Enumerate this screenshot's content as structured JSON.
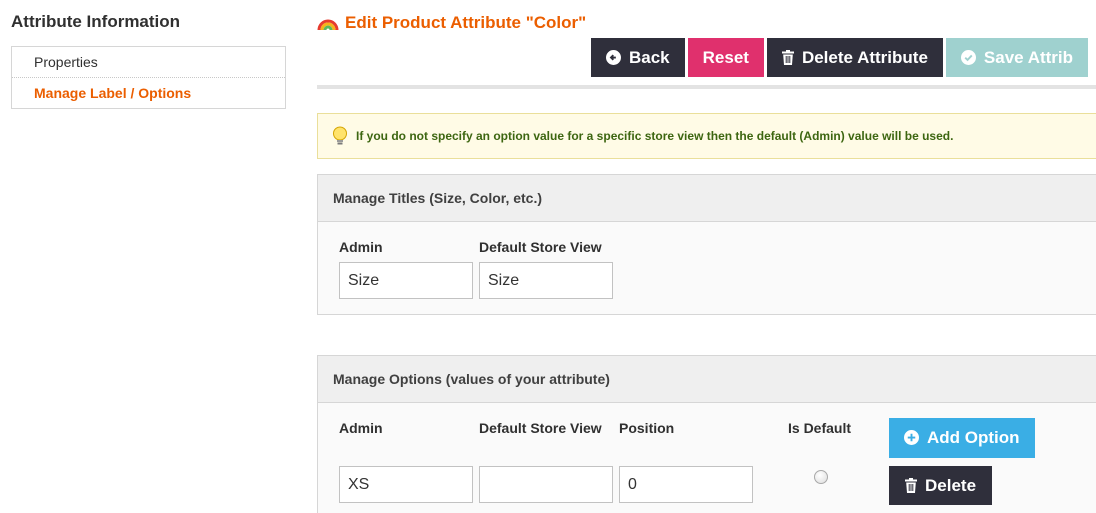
{
  "sidebar": {
    "title": "Attribute Information",
    "items": [
      {
        "label": "Properties"
      },
      {
        "label": "Manage Label / Options"
      }
    ]
  },
  "header": {
    "title": "Edit Product Attribute \"Color\"",
    "buttons": {
      "back": "Back",
      "reset": "Reset",
      "delete": "Delete Attribute",
      "save": "Save Attrib"
    }
  },
  "notice": {
    "text": "If you do not specify an option value for a specific store view then the default (Admin) value will be used."
  },
  "titles_section": {
    "heading": "Manage Titles (Size, Color, etc.)",
    "columns": {
      "admin": "Admin",
      "store": "Default Store View"
    },
    "values": {
      "admin": "Size",
      "store": "Size"
    }
  },
  "options_section": {
    "heading": "Manage Options (values of your attribute)",
    "columns": {
      "admin": "Admin",
      "store": "Default Store View",
      "position": "Position",
      "is_default": "Is Default"
    },
    "add_button": "Add Option",
    "rows": [
      {
        "admin": "XS",
        "store": "",
        "position": "0",
        "is_default": false,
        "delete_label": "Delete"
      }
    ]
  },
  "colors": {
    "accent": "#eb5e00",
    "dark_button": "#2f2f3b",
    "reset_button": "#e0306d",
    "save_button": "#9fd1cf",
    "add_button": "#3aaee5",
    "notice_text": "#3d6611"
  }
}
